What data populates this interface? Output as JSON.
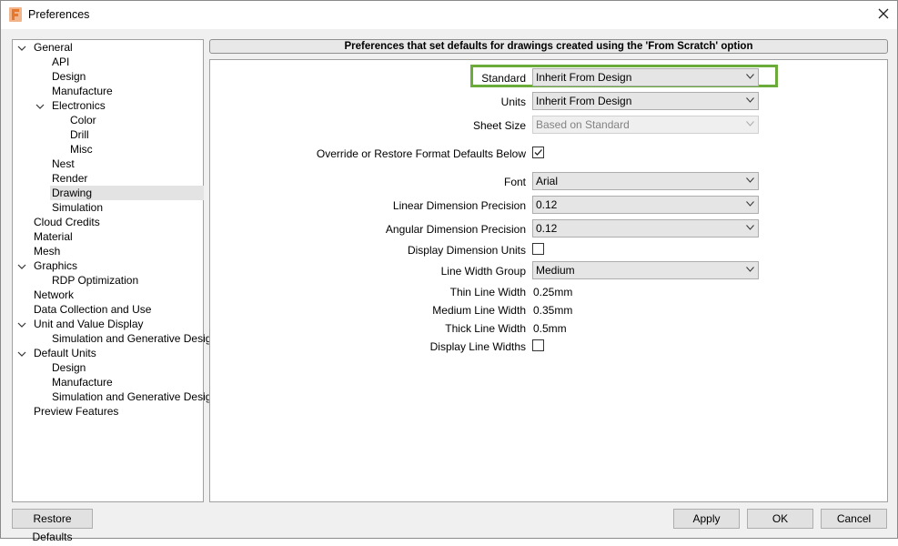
{
  "window": {
    "title": "Preferences"
  },
  "tree": {
    "items": [
      {
        "label": "General"
      },
      {
        "label": "API"
      },
      {
        "label": "Design"
      },
      {
        "label": "Manufacture"
      },
      {
        "label": "Electronics"
      },
      {
        "label": "Color"
      },
      {
        "label": "Drill"
      },
      {
        "label": "Misc"
      },
      {
        "label": "Nest"
      },
      {
        "label": "Render"
      },
      {
        "label": "Drawing",
        "selected": true
      },
      {
        "label": "Simulation"
      },
      {
        "label": "Cloud Credits"
      },
      {
        "label": "Material"
      },
      {
        "label": "Mesh"
      },
      {
        "label": "Graphics"
      },
      {
        "label": "RDP Optimization"
      },
      {
        "label": "Network"
      },
      {
        "label": "Data Collection and Use"
      },
      {
        "label": "Unit and Value Display"
      },
      {
        "label": "Simulation and Generative Design"
      },
      {
        "label": "Default Units"
      },
      {
        "label": "Design"
      },
      {
        "label": "Manufacture"
      },
      {
        "label": "Simulation and Generative Design"
      },
      {
        "label": "Preview Features"
      }
    ]
  },
  "header": {
    "text": "Preferences that set defaults for drawings created using the 'From Scratch' option"
  },
  "form": {
    "standard": {
      "label": "Standard",
      "value": "Inherit From Design"
    },
    "units": {
      "label": "Units",
      "value": "Inherit From Design"
    },
    "sheet_size": {
      "label": "Sheet Size",
      "value": "Based on Standard",
      "disabled": true
    },
    "override": {
      "label": "Override or Restore Format Defaults Below",
      "checked": true
    },
    "font": {
      "label": "Font",
      "value": "Arial"
    },
    "linear_precision": {
      "label": "Linear Dimension Precision",
      "value": "0.12"
    },
    "angular_precision": {
      "label": "Angular Dimension Precision",
      "value": "0.12"
    },
    "display_dim_units": {
      "label": "Display Dimension Units",
      "checked": false
    },
    "line_width_group": {
      "label": "Line Width Group",
      "value": "Medium"
    },
    "thin_line_width": {
      "label": "Thin Line Width",
      "value": "0.25mm"
    },
    "medium_line_width": {
      "label": "Medium Line Width",
      "value": "0.35mm"
    },
    "thick_line_width": {
      "label": "Thick Line Width",
      "value": "0.5mm"
    },
    "display_line_widths": {
      "label": "Display Line Widths",
      "checked": false
    }
  },
  "buttons": {
    "restore": "Restore Defaults",
    "apply": "Apply",
    "ok": "OK",
    "cancel": "Cancel"
  },
  "colors": {
    "highlight": "#6bab3a",
    "app_icon": "#e8772e",
    "selection": "#e3e3e3"
  },
  "icons": {
    "app": "fusion-app-icon",
    "close": "close-icon",
    "expand": "chevron-down-icon",
    "dropdown": "dropdown-arrow-icon",
    "check": "checkmark-icon"
  }
}
